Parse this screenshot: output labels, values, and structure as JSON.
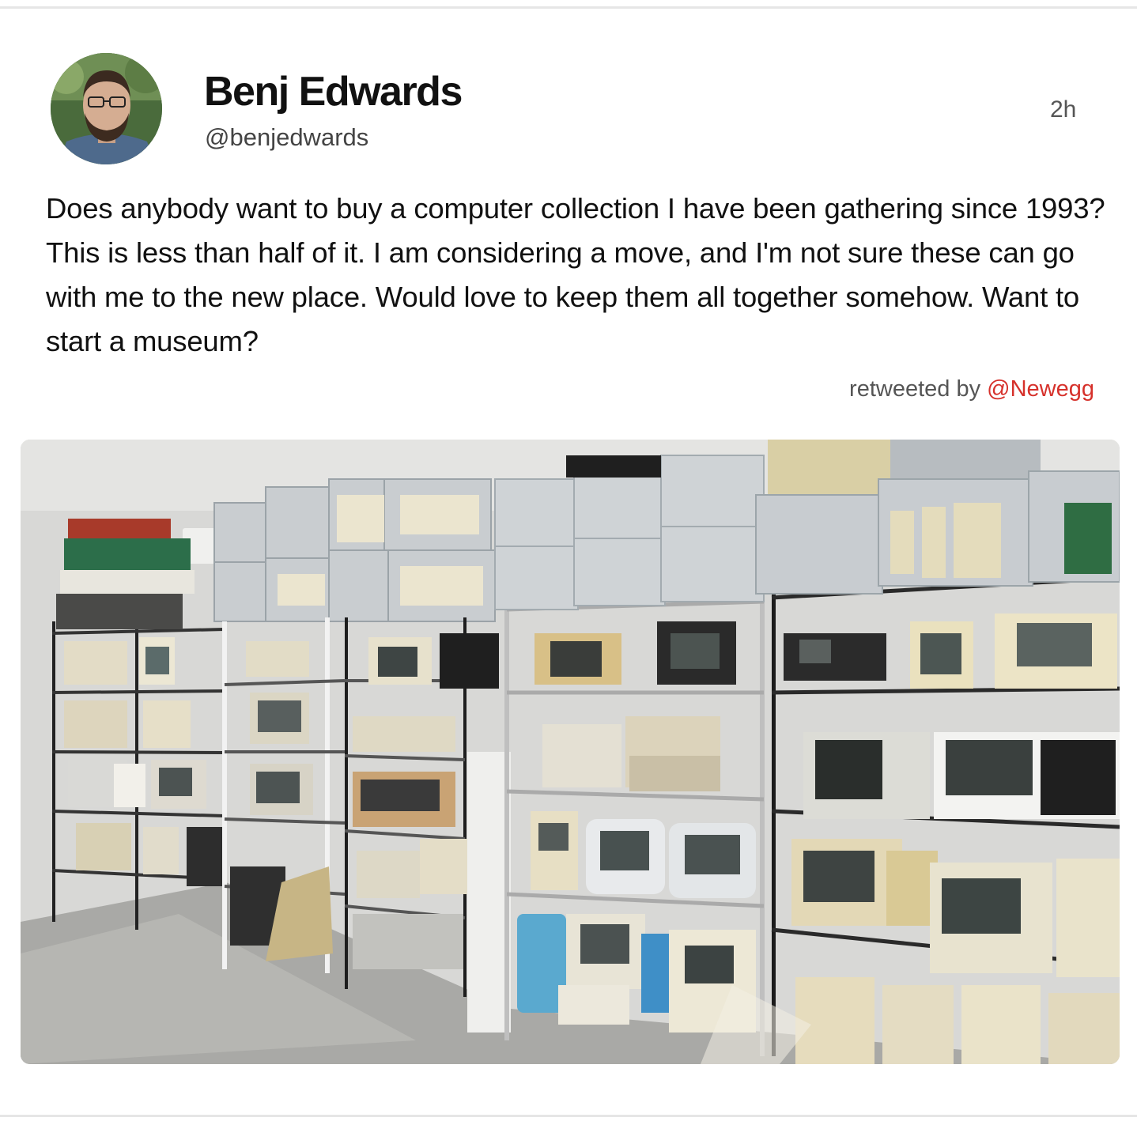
{
  "tweet": {
    "author_name": "Benj Edwards",
    "author_handle": "@benjedwards",
    "timestamp": "2h",
    "text": "Does anybody want to buy a computer collection I have been gathering since 1993?  This is less than half of it. I am considering a move, and I'm not sure these can go with me to the new place. Would love to keep them all together somehow. Want to start a museum?",
    "retweeted_by_prefix": "retweeted by",
    "retweeted_by_user": "@Newegg",
    "retweeted_by_color": "#d6312b"
  },
  "media": {
    "icon": "photo-icon"
  }
}
